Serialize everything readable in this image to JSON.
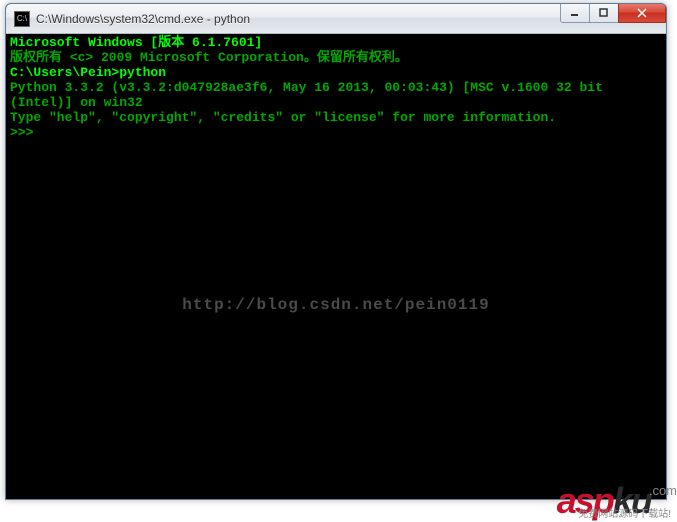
{
  "window": {
    "title": "C:\\Windows\\system32\\cmd.exe - python",
    "icon_char": "C:\\"
  },
  "terminal": {
    "line1": "Microsoft Windows [版本 6.1.7601]",
    "line2": "版权所有 <c> 2009 Microsoft Corporation。保留所有权利。",
    "line3": "",
    "line4": "C:\\Users\\Pein>python",
    "line5": "Python 3.3.2 (v3.3.2:d047928ae3f6, May 16 2013, 00:03:43) [MSC v.1600 32 bit (Intel)] on win32",
    "line6": "Type \"help\", \"copyright\", \"credits\" or \"license\" for more information.",
    "line7": ">>>"
  },
  "watermark": "http://blog.csdn.net/pein0119",
  "logo": {
    "part1": "asp",
    "part2": "ku",
    "tld": ".com",
    "subtitle": "免费网站源码下载站!"
  }
}
